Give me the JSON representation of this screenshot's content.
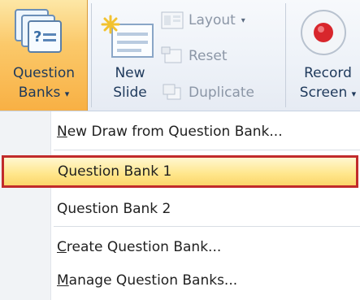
{
  "ribbon": {
    "question_banks": {
      "line1": "Question",
      "line2": "Banks",
      "caret": "▾"
    },
    "new_slide": {
      "line1": "New",
      "line2": "Slide"
    },
    "layout": {
      "label": "Layout",
      "caret": "▾"
    },
    "reset": {
      "label": "Reset"
    },
    "duplicate": {
      "label": "Duplicate"
    },
    "record_screen": {
      "line1": "Record",
      "line2": "Screen",
      "caret": "▾"
    }
  },
  "menu": {
    "items": [
      {
        "underline": "N",
        "rest": "ew Draw from Question Bank...",
        "selected": false
      },
      {
        "label": "Question Bank 1",
        "selected": true
      },
      {
        "label": "Question Bank 2",
        "selected": false
      },
      {
        "underline": "C",
        "rest": "reate Question Bank...",
        "selected": false
      },
      {
        "underline": "M",
        "rest": "anage Question Banks...",
        "selected": false
      }
    ]
  },
  "colors": {
    "accent": "#f8b044",
    "highlight_border": "#c12b2b",
    "text": "#1e395b"
  }
}
